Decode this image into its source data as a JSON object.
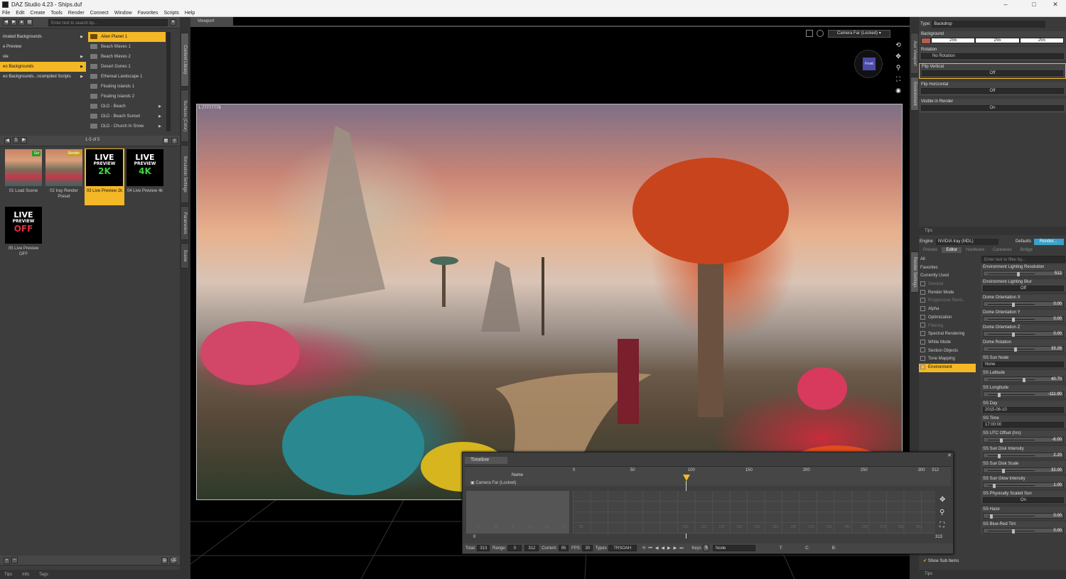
{
  "window": {
    "title": "DAZ Studio 4.23 - Ships.duf",
    "min": "–",
    "max": "□",
    "close": "✕"
  },
  "menu": [
    "File",
    "Edit",
    "Create",
    "Tools",
    "Render",
    "Connect",
    "Window",
    "Favorites",
    "Scripts",
    "Help"
  ],
  "content_library": {
    "search_placeholder": "Enter text to search by...",
    "tree": [
      {
        "label": "imated Backgrounds",
        "arrow": "▶"
      },
      {
        "label": "e Preview",
        "arrow": ""
      },
      {
        "label": "vie",
        "arrow": "▶"
      },
      {
        "label": "eo Backgrounds",
        "arrow": "▶",
        "selected": true
      },
      {
        "label": "eo Backgrounds...ncompiled Scripts",
        "arrow": "▶"
      }
    ],
    "folders": [
      {
        "label": "Alien Planet 1",
        "selected": true
      },
      {
        "label": "Beach Waves 1"
      },
      {
        "label": "Beach Waves 2"
      },
      {
        "label": "Desert Dunes 1"
      },
      {
        "label": "Ethereal Landscape 1"
      },
      {
        "label": "Floating Islands 1"
      },
      {
        "label": "Floating Islands 2"
      },
      {
        "label": "OLD - Beach",
        "arrow": "▶"
      },
      {
        "label": "OLD - Beach Sunset",
        "arrow": "▶"
      },
      {
        "label": "OLD - Church In Snow",
        "arrow": "▶"
      }
    ],
    "pager": {
      "page": "1",
      "count": "1-5 of 5"
    },
    "items": [
      {
        "label": "01 Load Scene",
        "badge": "Set"
      },
      {
        "label": "02 Iray Render Preset",
        "badge": "Render"
      },
      {
        "label": "03 Live Preview 2k",
        "l1": "LIVE",
        "l2": "PREVIEW",
        "l3": "2K"
      },
      {
        "label": "04 Live Preview 4k",
        "l1": "LIVE",
        "l2": "PREVIEW",
        "l3": "4K"
      },
      {
        "label": "05 Live Preview OFF",
        "l1": "LIVE",
        "l2": "PREVIEW",
        "l3": "OFF"
      }
    ],
    "bottom_tabs": [
      "Tips",
      "Info",
      "Tags"
    ],
    "add": "+",
    "remove": "–"
  },
  "side_tabs_left": [
    "Content Library",
    "Surfaces (Color)",
    "Simulation Settings",
    "Parameters",
    "Scene"
  ],
  "viewport": {
    "tab": "Viewport",
    "camera": "Camera Far (Locked)",
    "ratio_label": "1.77777778",
    "cube_label": "Front"
  },
  "environment_panel": {
    "type_label": "Type:",
    "type_value": "Backdrop",
    "background_label": "Background",
    "rgb": [
      "255",
      "255",
      "255"
    ],
    "rotation_label": "Rotation",
    "rotation_value": "No Rotation",
    "flip_v_label": "Flip Vertical",
    "flip_v_value": "Off",
    "flip_h_label": "Flip Horizontal",
    "flip_h_value": "Off",
    "visible_label": "Visible in Render",
    "visible_value": "On",
    "tips": "Tips"
  },
  "side_tabs_right": [
    "Aux Viewport",
    "Environment",
    "Render Settings"
  ],
  "render_settings": {
    "engine_label": "Engine",
    "engine_value": "NVIDIA Iray (MDL)",
    "defaults": "Defaults",
    "render": "Render...",
    "tabs": [
      "Presets",
      "Editor",
      "Hardware",
      "Canvases",
      "Bridge"
    ],
    "filter_placeholder": "Enter text to filter by...",
    "categories": [
      {
        "label": "All"
      },
      {
        "label": "Favorites"
      },
      {
        "label": "Currently Used"
      },
      {
        "label": "General",
        "dim": true
      },
      {
        "label": "Render Mode"
      },
      {
        "label": "Progressive Rend...",
        "dim": true
      },
      {
        "label": "Alpha"
      },
      {
        "label": "Optimization"
      },
      {
        "label": "Filtering",
        "dim": true
      },
      {
        "label": "Spectral Rendering"
      },
      {
        "label": "White Mode"
      },
      {
        "label": "Section Objects"
      },
      {
        "label": "Tone Mapping"
      },
      {
        "label": "Environment",
        "selected": true
      }
    ],
    "props": [
      {
        "label": "Environment Lighting Resolution",
        "value": "512",
        "pos": 0.6
      },
      {
        "label": "Environment Lighting Blur",
        "value": "Off",
        "kind": "toggle"
      },
      {
        "label": "Dome Orientation X",
        "value": "0.00",
        "pos": 0.5
      },
      {
        "label": "Dome Orientation Y",
        "value": "0.00",
        "pos": 0.5
      },
      {
        "label": "Dome Orientation Z",
        "value": "0.00",
        "pos": 0.5
      },
      {
        "label": "Dome Rotation",
        "value": "33.28",
        "pos": 0.55
      },
      {
        "label": "SS Sun Node",
        "value": "None",
        "kind": "text"
      },
      {
        "label": "SS Latitude",
        "value": "40.70",
        "pos": 0.72
      },
      {
        "label": "SS Longitude",
        "value": "-111.90",
        "pos": 0.2
      },
      {
        "label": "SS Day",
        "value": "2015-06-10",
        "kind": "text"
      },
      {
        "label": "SS Time",
        "value": "17:00:00",
        "kind": "text"
      },
      {
        "label": "SS UTC Offset (hrs)",
        "value": "-6.00",
        "pos": 0.25
      },
      {
        "label": "SS Sun Disk Intensity",
        "value": "2.20",
        "pos": 0.2
      },
      {
        "label": "SS Sun Disk Scale",
        "value": "32.00",
        "pos": 0.3
      },
      {
        "label": "SS Sun Glow Intensity",
        "value": "1.00",
        "pos": 0.1
      },
      {
        "label": "SS Physically Scaled Sun",
        "value": "On",
        "kind": "toggle"
      },
      {
        "label": "SS Haze",
        "value": "0.00",
        "pos": 0.05
      },
      {
        "label": "SS Blue-Red Tint",
        "value": "0.00",
        "pos": 0.5
      }
    ],
    "show_sub": "Show Sub Items",
    "tips": "Tips"
  },
  "timeline": {
    "title": "Timeline",
    "name_col": "Name",
    "track": "Camera Far (Locked)",
    "ruler": [
      "0",
      "50",
      "100",
      "150",
      "200",
      "250",
      "300",
      "312"
    ],
    "grid": [
      "0",
      "15",
      "30",
      "45",
      "60",
      "75",
      "90",
      "105",
      "120",
      "135",
      "150",
      "165",
      "180",
      "195",
      "210",
      "225",
      "240",
      "255",
      "270",
      "285",
      "300"
    ],
    "row_start": "0",
    "row_end": "313",
    "total_label": "Total:",
    "total": "313",
    "range_label": "Range:",
    "range_start": "0",
    "range_end": "312",
    "current_label": "Current:",
    "current": "95",
    "fps_label": "FPS:",
    "fps": "30",
    "types_label": "Types",
    "types": "TRSOAH",
    "keys_label": "Keys",
    "node": "Node",
    "t_label": "T:",
    "c_label": "C:",
    "b_label": "B:"
  }
}
